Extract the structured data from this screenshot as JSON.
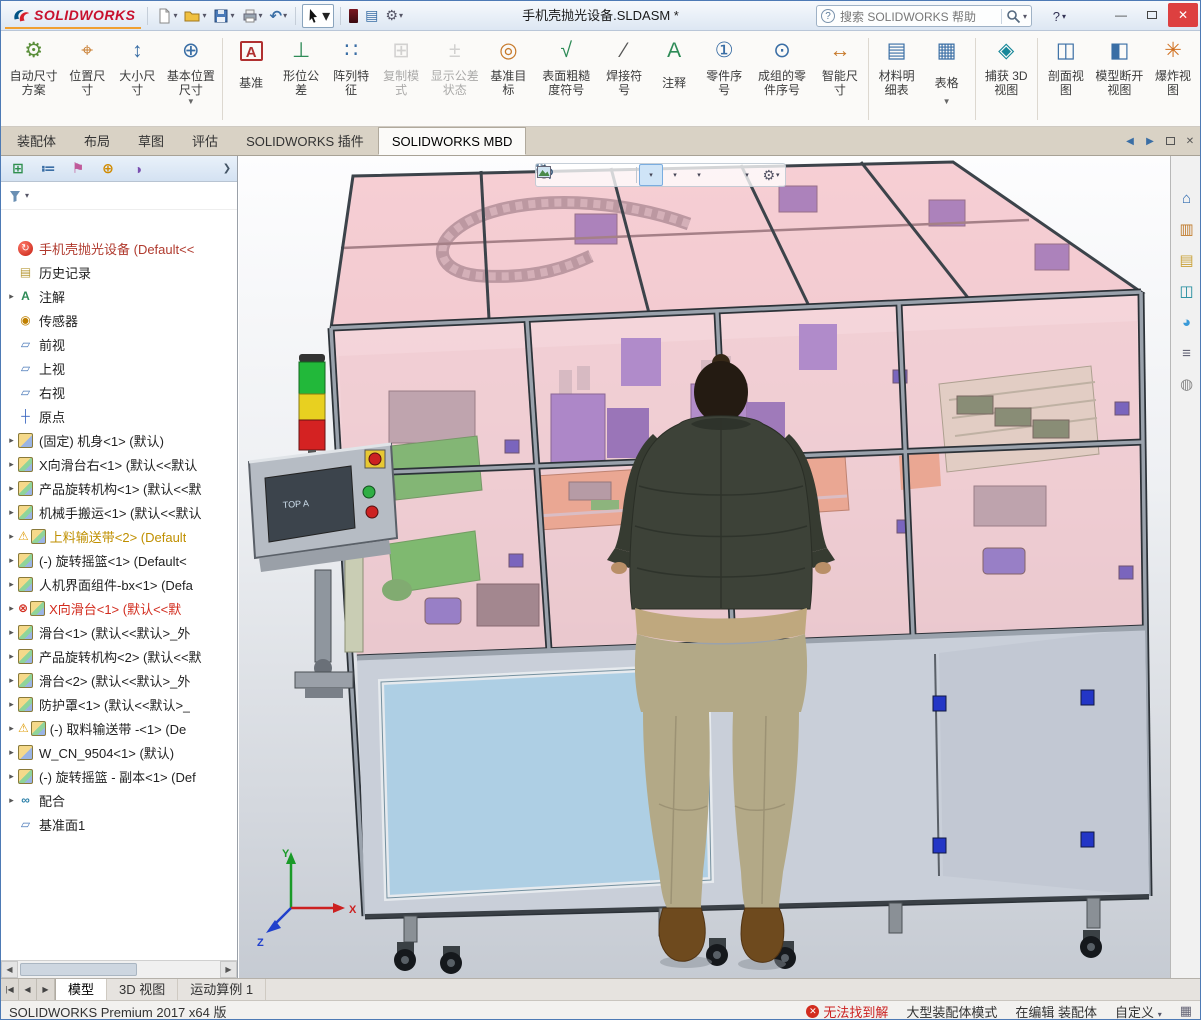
{
  "titlebar": {
    "brand": "SOLIDWORKS",
    "document_title": "手机壳抛光设备.SLDASM *",
    "search_placeholder": "搜索 SOLIDWORKS 帮助",
    "help_label": "?",
    "minimize_glyph": "—",
    "close_glyph": "✕",
    "quick_tools": [
      "new-document",
      "open-document",
      "save",
      "print",
      "undo",
      "select-tool",
      "color-swatch",
      "table",
      "options-gear"
    ]
  },
  "ribbon": {
    "buttons": [
      {
        "label": "自动尺寸方案",
        "glyph": "⚙",
        "glyph_color": "#5b8f3b",
        "caret": ""
      },
      {
        "label": "位置尺寸",
        "glyph": "⌖",
        "glyph_color": "#c7792a",
        "caret": ""
      },
      {
        "label": "大小尺寸",
        "glyph": "↕",
        "glyph_color": "#3a6ea5",
        "caret": ""
      },
      {
        "label": "基本位置尺寸",
        "glyph": "⊕",
        "glyph_color": "#3a6ea5",
        "caret": "▼"
      },
      {
        "label": "基准",
        "glyph": "A",
        "glyph_color": "#b03030",
        "caret": ""
      },
      {
        "label": "形位公差",
        "glyph": "⊥",
        "glyph_color": "#2e8b57",
        "caret": ""
      },
      {
        "label": "阵列特征",
        "glyph": "∷",
        "glyph_color": "#3a6ea5",
        "caret": ""
      },
      {
        "label": "复制模式",
        "glyph": "⊞",
        "glyph_color": "#9a9a9a",
        "caret": ""
      },
      {
        "label": "显示公差状态",
        "glyph": "±",
        "glyph_color": "#9a9a9a",
        "caret": ""
      },
      {
        "label": "基准目标",
        "glyph": "◎",
        "glyph_color": "#c7792a",
        "caret": ""
      },
      {
        "label": "表面粗糙度符号",
        "glyph": "√",
        "glyph_color": "#2e8b57",
        "caret": ""
      },
      {
        "label": "焊接符号",
        "glyph": "∕",
        "glyph_color": "#555555",
        "caret": ""
      },
      {
        "label": "注释",
        "glyph": "A",
        "glyph_color": "#2e8b57",
        "caret": ""
      },
      {
        "label": "零件序号",
        "glyph": "①",
        "glyph_color": "#3a6ea5",
        "caret": ""
      },
      {
        "label": "成组的零件序号",
        "glyph": "⊙",
        "glyph_color": "#3a6ea5",
        "caret": ""
      },
      {
        "label": "智能尺寸",
        "glyph": "↔",
        "glyph_color": "#c7792a",
        "caret": ""
      },
      {
        "label": "材料明细表",
        "glyph": "▤",
        "glyph_color": "#3a6ea5",
        "caret": ""
      },
      {
        "label": "表格",
        "glyph": "▦",
        "glyph_color": "#3a6ea5",
        "caret": "▼"
      },
      {
        "label": "捕获 3D 视图",
        "glyph": "◈",
        "glyph_color": "#18889a",
        "caret": ""
      },
      {
        "label": "剖面视图",
        "glyph": "◫",
        "glyph_color": "#3a6ea5",
        "caret": ""
      },
      {
        "label": "模型断开视图",
        "glyph": "◧",
        "glyph_color": "#3a6ea5",
        "caret": ""
      },
      {
        "label": "爆炸视图",
        "glyph": "✳",
        "glyph_color": "#d07020",
        "caret": ""
      }
    ]
  },
  "command_tabs": {
    "items": [
      "装配体",
      "布局",
      "草图",
      "评估",
      "SOLIDWORKS 插件",
      "SOLIDWORKS MBD"
    ],
    "active": "SOLIDWORKS MBD"
  },
  "feature_panel": {
    "tabs": [
      "featuremanager-design-tree",
      "propertymanager",
      "configurationmanager",
      "dimxpertmanager",
      "displaymanager"
    ],
    "tree": {
      "items": [
        {
          "arrow": "",
          "icon": "assembly-root",
          "badge": "",
          "label": "手机壳抛光设备 (Default<<",
          "color": "#b03a2e"
        },
        {
          "arrow": "",
          "icon": "history",
          "badge": "",
          "label": "历史记录"
        },
        {
          "arrow": "▸",
          "icon": "annotations",
          "badge": "",
          "label": "注解"
        },
        {
          "arrow": "",
          "icon": "sensors",
          "badge": "",
          "label": "传感器"
        },
        {
          "arrow": "",
          "icon": "plane",
          "badge": "",
          "label": "前视"
        },
        {
          "arrow": "",
          "icon": "plane",
          "badge": "",
          "label": "上视"
        },
        {
          "arrow": "",
          "icon": "plane",
          "badge": "",
          "label": "右视"
        },
        {
          "arrow": "",
          "icon": "origin",
          "badge": "",
          "label": "原点"
        },
        {
          "arrow": "▸",
          "icon": "part",
          "badge": "",
          "label": "(固定) 机身<1> (默认)"
        },
        {
          "arrow": "▸",
          "icon": "subassembly",
          "badge": "",
          "label": "X向滑台右<1> (默认<<默认"
        },
        {
          "arrow": "▸",
          "icon": "subassembly",
          "badge": "",
          "label": "产品旋转机构<1> (默认<<默"
        },
        {
          "arrow": "▸",
          "icon": "subassembly",
          "badge": "",
          "label": "机械手搬运<1> (默认<<默认"
        },
        {
          "arrow": "▸",
          "icon": "subassembly",
          "badge": "⚠",
          "badge_color": "#e0a010",
          "label": "上料输送带<2> (Default",
          "color": "#bf8f00"
        },
        {
          "arrow": "▸",
          "icon": "subassembly",
          "badge": "",
          "label": "(-) 旋转摇篮<1> (Default<"
        },
        {
          "arrow": "▸",
          "icon": "subassembly",
          "badge": "",
          "label": "人机界面组件-bx<1> (Defa"
        },
        {
          "arrow": "▸",
          "icon": "subassembly",
          "badge": "⊗",
          "badge_color": "#d22c1e",
          "label": "X向滑台<1> (默认<<默",
          "color": "#d22c1e"
        },
        {
          "arrow": "▸",
          "icon": "subassembly",
          "badge": "",
          "label": "滑台<1> (默认<<默认>_外"
        },
        {
          "arrow": "▸",
          "icon": "subassembly",
          "badge": "",
          "label": "产品旋转机构<2> (默认<<默"
        },
        {
          "arrow": "▸",
          "icon": "subassembly",
          "badge": "",
          "label": "滑台<2> (默认<<默认>_外"
        },
        {
          "arrow": "▸",
          "icon": "subassembly",
          "badge": "",
          "label": "防护罩<1> (默认<<默认>_"
        },
        {
          "arrow": "▸",
          "icon": "subassembly",
          "badge": "⚠",
          "badge_color": "#e0a010",
          "label": "(-) 取料输送带 -<1> (De"
        },
        {
          "arrow": "▸",
          "icon": "part",
          "badge": "",
          "label": "W_CN_9504<1> (默认)"
        },
        {
          "arrow": "▸",
          "icon": "subassembly",
          "badge": "",
          "label": "(-) 旋转摇篮 - 副本<1> (Def"
        },
        {
          "arrow": "▸",
          "icon": "mates",
          "badge": "",
          "label": "配合"
        },
        {
          "arrow": "",
          "icon": "plane",
          "badge": "",
          "label": "基准面1"
        }
      ]
    }
  },
  "viewport": {
    "hud": [
      "zoom-fit",
      "zoom-to-area",
      "previous-view",
      "section-view",
      "view-orientation",
      "display-style",
      "hide-show-items",
      "edit-appearance",
      "apply-scene",
      "view-settings"
    ],
    "control_panel_screen_label": "TOP A",
    "triad": {
      "x": "X",
      "y": "Y",
      "z": "Z"
    }
  },
  "task_pane": {
    "icons": [
      "solidworks-resources",
      "design-library",
      "file-explorer",
      "view-palette",
      "appearances-scenes",
      "custom-properties",
      "solidworks-forum"
    ]
  },
  "bottom_tabs": {
    "items": [
      "模型",
      "3D 视图",
      "运动算例 1"
    ],
    "active": "模型"
  },
  "statusbar": {
    "product": "SOLIDWORKS Premium 2017 x64 版",
    "error": "无法找到解",
    "mode": "大型装配体模式",
    "editing": "在编辑 装配体",
    "custom": "自定义"
  }
}
